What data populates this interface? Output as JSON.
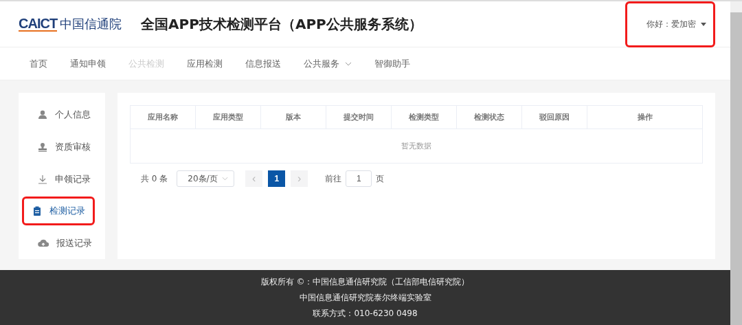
{
  "header": {
    "logo_mark": "CAICT",
    "logo_name": "中国信通院",
    "title": "全国APP技术检测平台（APP公共服务系统）",
    "user": {
      "greeting": "你好：爱加密",
      "highlighted": true
    }
  },
  "nav": [
    {
      "label": "首页",
      "disabled": false,
      "dropdown": false
    },
    {
      "label": "通知申领",
      "disabled": false,
      "dropdown": false
    },
    {
      "label": "公共检测",
      "disabled": true,
      "dropdown": false
    },
    {
      "label": "应用检测",
      "disabled": false,
      "dropdown": false
    },
    {
      "label": "信息报送",
      "disabled": false,
      "dropdown": false
    },
    {
      "label": "公共服务",
      "disabled": false,
      "dropdown": true
    },
    {
      "label": "智御助手",
      "disabled": false,
      "dropdown": false
    }
  ],
  "sidebar": {
    "items": [
      {
        "label": "个人信息",
        "kind": "person",
        "selected": false,
        "highlighted": false
      },
      {
        "label": "资质审核",
        "kind": "stamp",
        "selected": false,
        "highlighted": false
      },
      {
        "label": "申领记录",
        "kind": "download",
        "selected": false,
        "highlighted": false
      },
      {
        "label": "检测记录",
        "kind": "clipboard",
        "selected": true,
        "highlighted": true
      },
      {
        "label": "报送记录",
        "kind": "upload",
        "selected": false,
        "highlighted": false
      }
    ]
  },
  "table": {
    "columns": [
      "应用名称",
      "应用类型",
      "版本",
      "提交时间",
      "检测类型",
      "检测状态",
      "驳回原因",
      "操作"
    ],
    "empty_text": "暂无数据"
  },
  "pagination": {
    "total": "共 0 条",
    "page_size": "20条/页",
    "prev": "‹",
    "pages": [
      {
        "label": "1",
        "selected": true
      }
    ],
    "next": "›",
    "goto_label": "前往",
    "goto_value": "1",
    "goto_unit": "页"
  },
  "footer": [
    "版权所有 ©：中国信息通信研究院（工信部电信研究院）",
    "中国信息通信研究院泰尔终端实验室",
    "联系方式：010-6230 0498"
  ]
}
